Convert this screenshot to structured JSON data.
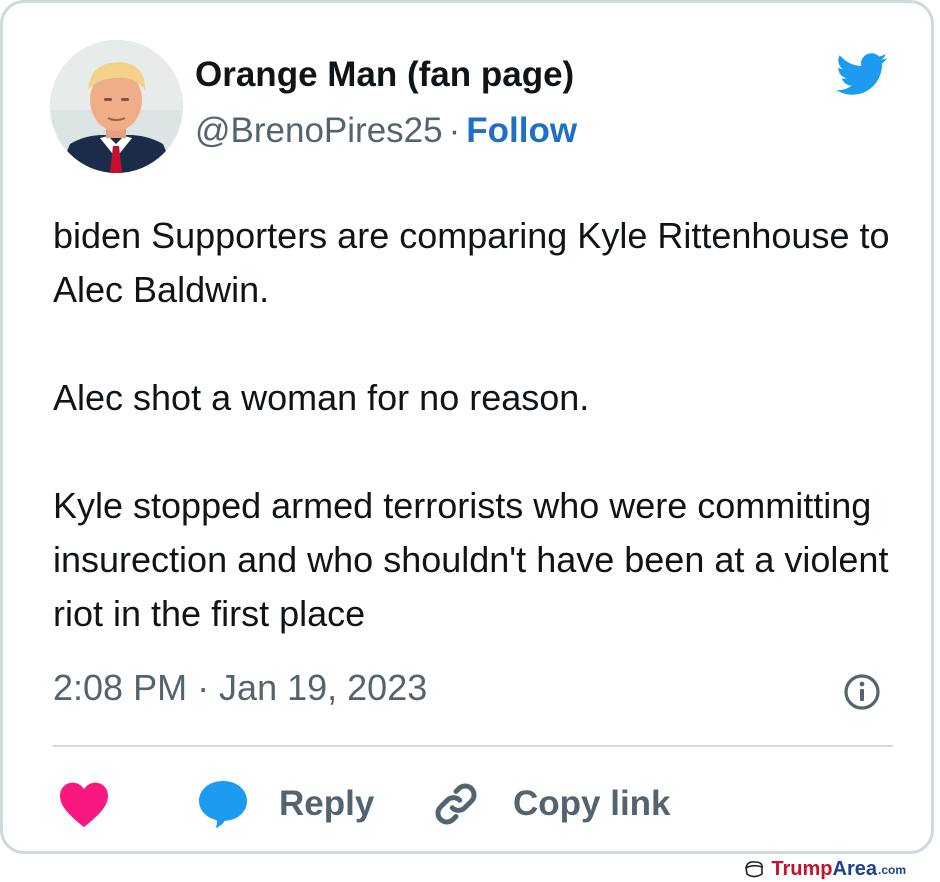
{
  "tweet": {
    "author": {
      "display_name": "Orange Man (fan page)",
      "handle": "@BrenoPires25",
      "separator": "·",
      "follow_label": "Follow"
    },
    "paragraphs": [
      "biden Supporters are comparing Kyle Rittenhouse to Alec Baldwin.",
      "Alec shot a woman for no reason.",
      "Kyle stopped armed terrorists who were committing insurection and who shouldn't have been at a violent riot in the first place"
    ],
    "timestamp": "2:08 PM · Jan 19, 2023",
    "actions": {
      "reply_label": "Reply",
      "copy_link_label": "Copy link"
    },
    "icons": {
      "brand": "twitter-bird-icon",
      "info": "info-icon",
      "like": "heart-icon",
      "reply": "speech-bubble-icon",
      "copy": "link-icon"
    }
  },
  "watermark": {
    "part1": "Trump",
    "part2": "Area",
    "part3": ".com"
  },
  "colors": {
    "twitter_blue": "#1d9bf0",
    "follow_blue": "#1d6fc9",
    "heart_pink": "#f91880",
    "secondary_text": "#536471",
    "primary_text": "#0f1419",
    "border": "#cfd9de"
  }
}
